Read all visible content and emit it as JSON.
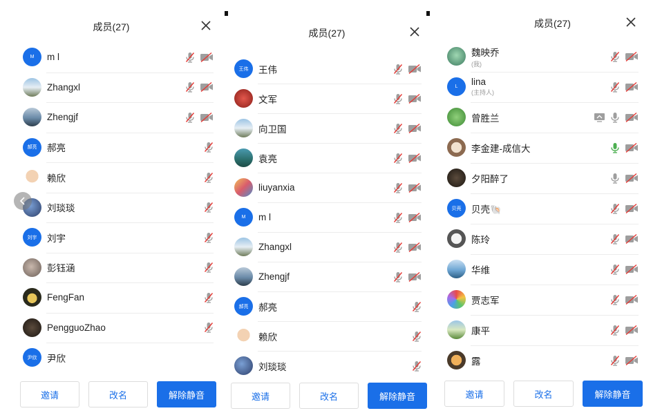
{
  "colors": {
    "accent": "#1a6fe8",
    "mic_off": "#9e9e9e",
    "mic_on": "#4caf50",
    "divider": "#ececec"
  },
  "panels": [
    {
      "title": "成员(27)",
      "members": [
        {
          "name": "m l",
          "avatar_text": "M",
          "avatar_kind": "letter",
          "mic": "off",
          "camera": "off"
        },
        {
          "name": "Zhangxl",
          "avatar_text": "",
          "avatar_kind": "photo-sky",
          "mic": "off",
          "camera": "off"
        },
        {
          "name": "Zhengjf",
          "avatar_text": "",
          "avatar_kind": "photo-lake",
          "mic": "off",
          "camera": "off"
        },
        {
          "name": "郝亮",
          "avatar_text": "郝亮",
          "avatar_kind": "letter",
          "mic": "off",
          "camera": "none"
        },
        {
          "name": "赖欣",
          "avatar_text": "",
          "avatar_kind": "photo-baby",
          "mic": "off",
          "camera": "none"
        },
        {
          "name": "刘琰琰",
          "avatar_text": "",
          "avatar_kind": "photo-blue",
          "mic": "off",
          "camera": "none"
        },
        {
          "name": "刘宇",
          "avatar_text": "刘宇",
          "avatar_kind": "letter",
          "mic": "off",
          "camera": "none"
        },
        {
          "name": "彭钰涵",
          "avatar_text": "",
          "avatar_kind": "photo-grey",
          "mic": "off",
          "camera": "none"
        },
        {
          "name": "FengFan",
          "avatar_text": "",
          "avatar_kind": "photo-owl",
          "mic": "off",
          "camera": "none"
        },
        {
          "name": "PengguoZhao",
          "avatar_text": "",
          "avatar_kind": "photo-dark",
          "mic": "off",
          "camera": "none"
        },
        {
          "name": "尹欣",
          "avatar_text": "尹欣",
          "avatar_kind": "letter",
          "mic": "none",
          "camera": "none"
        }
      ],
      "buttons": {
        "invite": "邀请",
        "rename": "改名",
        "unmute_all": "解除静音"
      }
    },
    {
      "title": "成员(27)",
      "members": [
        {
          "name": "王伟",
          "avatar_text": "王伟",
          "avatar_kind": "letter",
          "mic": "off",
          "camera": "off"
        },
        {
          "name": "文军",
          "avatar_text": "",
          "avatar_kind": "photo-red",
          "mic": "off",
          "camera": "off"
        },
        {
          "name": "向卫国",
          "avatar_text": "",
          "avatar_kind": "photo-sky",
          "mic": "off",
          "camera": "off"
        },
        {
          "name": "袁亮",
          "avatar_text": "",
          "avatar_kind": "photo-teal",
          "mic": "off",
          "camera": "off"
        },
        {
          "name": "liuyanxia",
          "avatar_text": "",
          "avatar_kind": "photo-art",
          "mic": "off",
          "camera": "off"
        },
        {
          "name": "m l",
          "avatar_text": "M",
          "avatar_kind": "letter",
          "mic": "off",
          "camera": "off"
        },
        {
          "name": "Zhangxl",
          "avatar_text": "",
          "avatar_kind": "photo-sky",
          "mic": "off",
          "camera": "off"
        },
        {
          "name": "Zhengjf",
          "avatar_text": "",
          "avatar_kind": "photo-lake",
          "mic": "off",
          "camera": "off"
        },
        {
          "name": "郝亮",
          "avatar_text": "郝亮",
          "avatar_kind": "letter",
          "mic": "off",
          "camera": "none"
        },
        {
          "name": "赖欣",
          "avatar_text": "",
          "avatar_kind": "photo-baby",
          "mic": "off",
          "camera": "none"
        },
        {
          "name": "刘琰琰",
          "avatar_text": "",
          "avatar_kind": "photo-blue",
          "mic": "off",
          "camera": "none"
        }
      ],
      "buttons": {
        "invite": "邀请",
        "rename": "改名",
        "unmute_all": "解除静音"
      }
    },
    {
      "title": "成员(27)",
      "members": [
        {
          "name": "魏映乔",
          "subtitle": "(我)",
          "avatar_text": "",
          "avatar_kind": "photo-cartoon",
          "mic": "off",
          "camera": "off"
        },
        {
          "name": "lina",
          "subtitle": "(主持人)",
          "avatar_text": "L",
          "avatar_kind": "letter",
          "mic": "off",
          "camera": "off"
        },
        {
          "name": "曾胜兰",
          "avatar_text": "",
          "avatar_kind": "photo-green",
          "mic": "on-grey",
          "camera": "off",
          "screen_share": true
        },
        {
          "name": "李金建-成信大",
          "avatar_text": "",
          "avatar_kind": "photo-cat",
          "mic": "on",
          "camera": "off"
        },
        {
          "name": "夕阳醉了",
          "avatar_text": "",
          "avatar_kind": "photo-dark",
          "mic": "on-grey",
          "camera": "off"
        },
        {
          "name": "贝壳🐚",
          "avatar_text": "贝壳",
          "avatar_kind": "letter",
          "mic": "off",
          "camera": "off"
        },
        {
          "name": "陈玲",
          "avatar_text": "",
          "avatar_kind": "photo-panda",
          "mic": "off",
          "camera": "off"
        },
        {
          "name": "华维",
          "avatar_text": "",
          "avatar_kind": "photo-sea",
          "mic": "off",
          "camera": "off"
        },
        {
          "name": "贾志军",
          "avatar_text": "",
          "avatar_kind": "photo-rainbow",
          "mic": "off",
          "camera": "off"
        },
        {
          "name": "康平",
          "avatar_text": "",
          "avatar_kind": "photo-field",
          "mic": "off",
          "camera": "off"
        },
        {
          "name": "露",
          "avatar_text": "",
          "avatar_kind": "photo-tiger",
          "mic": "off",
          "camera": "off"
        }
      ],
      "buttons": {
        "invite": "邀请",
        "rename": "改名",
        "unmute_all": "解除静音"
      }
    }
  ]
}
